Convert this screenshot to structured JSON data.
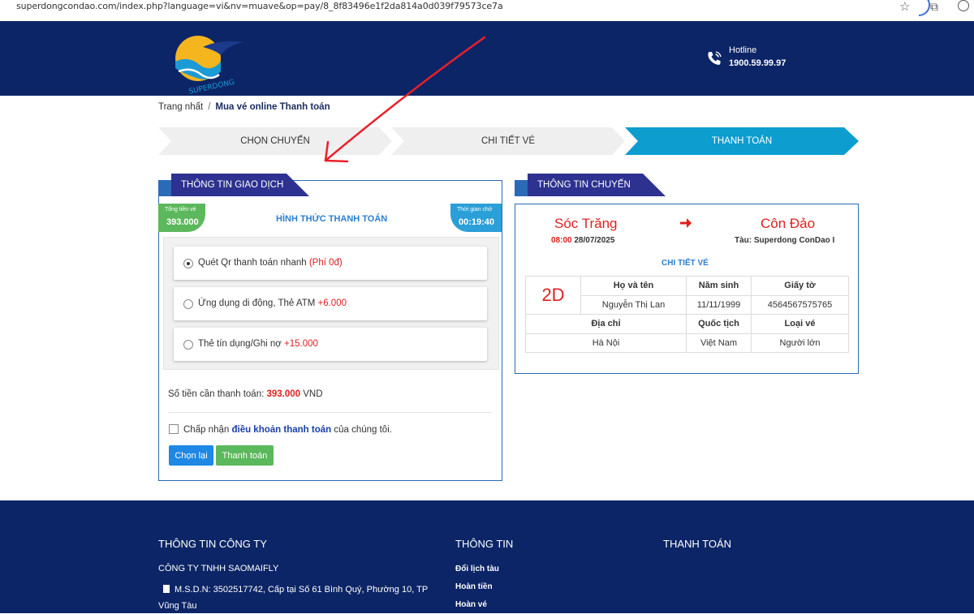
{
  "browser": {
    "url": "superdongcondao.com/index.php?language=vi&nv=muave&op=pay/8_8f83496e1f2da814a0d039f79573ce7a"
  },
  "header": {
    "logo_text": "SUPERDONG",
    "hotline_label": "Hotline",
    "hotline_number": "1900.59.99.97"
  },
  "breadcrumb": {
    "home": "Trang nhất",
    "separator": "/",
    "current": "Mua vé online Thanh toán"
  },
  "steps": [
    {
      "label": "CHỌN CHUYẾN",
      "active": false
    },
    {
      "label": "CHI TIẾT VÉ",
      "active": false
    },
    {
      "label": "THANH TOÁN",
      "active": true
    }
  ],
  "transaction": {
    "banner": "THÔNG TIN GIAO DỊCH",
    "total_label": "Tổng tiền vé",
    "total_value": "393.000",
    "wait_label": "Thời gian chờ",
    "wait_value": "00:19:40",
    "method_title": "HÌNH THỨC THANH TOÁN",
    "methods": [
      {
        "label": "Quét Qr thanh toán nhanh ",
        "fee": "(Phí 0đ)",
        "selected": true
      },
      {
        "label": "Ứng dụng di động, Thẻ ATM ",
        "fee": "+6.000",
        "selected": false
      },
      {
        "label": "Thẻ tín dụng/Ghi nợ ",
        "fee": "+15.000",
        "selected": false
      }
    ],
    "amount_label": "Số tiền cần thanh toán: ",
    "amount_value": "393.000",
    "amount_unit": " VND",
    "terms_prefix": "Chấp nhận ",
    "terms_link": "điều khoản thanh toán",
    "terms_suffix": " của chúng tôi.",
    "back_button": "Chọn lại",
    "pay_button": "Thanh toán"
  },
  "trip": {
    "banner": "THÔNG TIN CHUYẾN",
    "from": "Sóc Trăng",
    "to": "Côn Đảo",
    "dep_time": "08:00",
    "dep_date": " 28/07/2025",
    "vessel": "Tàu: Superdong ConDao I",
    "detail_title": "CHI TIẾT VÉ",
    "seat": "2D",
    "headers1": [
      "Họ và tên",
      "Năm sinh",
      "Giấy tờ"
    ],
    "row1": [
      "Nguyễn Thị Lan",
      "11/11/1999",
      "4564567575765"
    ],
    "headers2": [
      "Địa chỉ",
      "Quốc tịch",
      "Loại vé"
    ],
    "row2": [
      "Hà Nội",
      "Việt Nam",
      "Người lớn"
    ]
  },
  "footer": {
    "col1_title": "THÔNG TIN CÔNG TY",
    "col2_title": "THÔNG TIN",
    "col3_title": "THANH TOÁN",
    "company": "CÔNG TY TNHH SAOMAIFLY",
    "tax_info": "M.S.D.N: 3502517742, Cấp tại Số 61 Bình Quý, Phường 10, TP Vũng Tàu",
    "links": [
      "Đổi lịch tàu",
      "Hoàn tiền",
      "Hoàn vé"
    ]
  },
  "colors": {
    "navy": "#0c2566",
    "accent_blue": "#2b9fd8",
    "green": "#5cb85c",
    "red": "#e02020",
    "banner": "#2d3190"
  }
}
